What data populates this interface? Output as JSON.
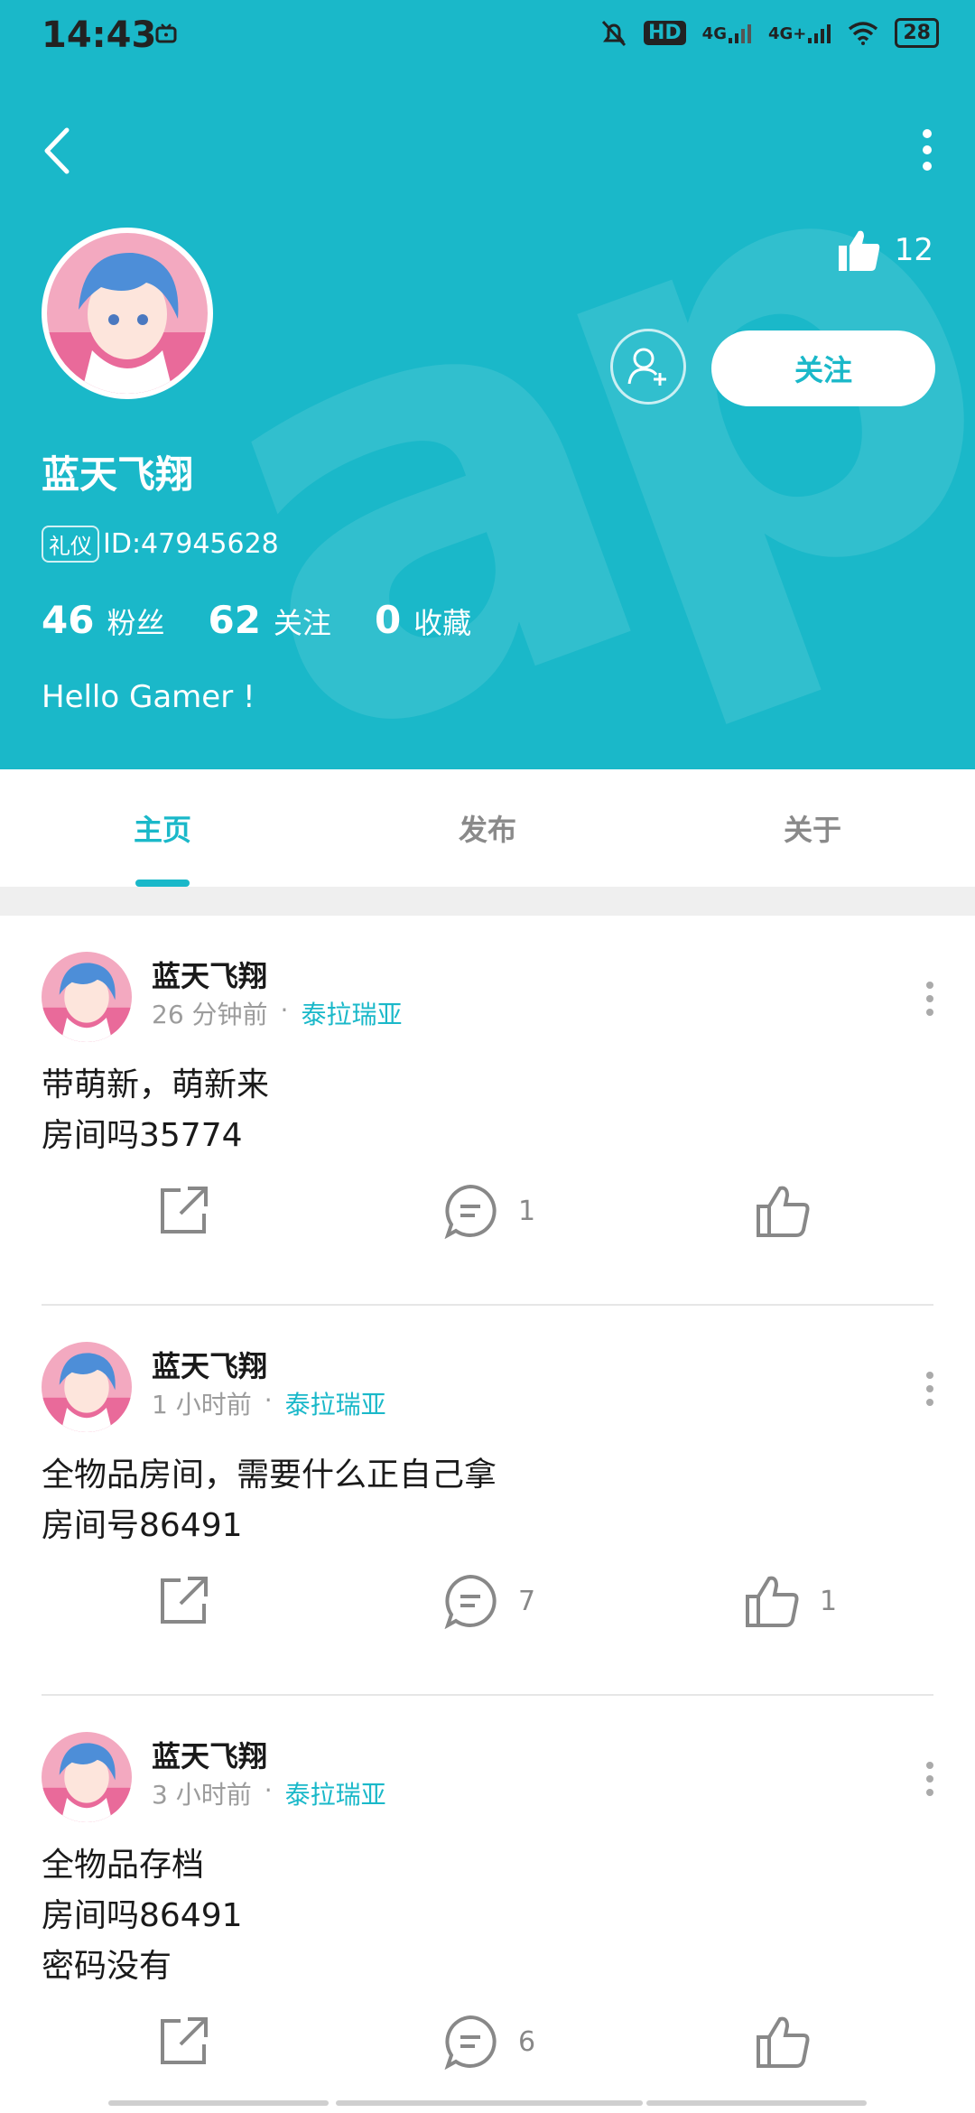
{
  "status_bar": {
    "time": "14:43",
    "battery": "28",
    "hd": "HD",
    "net1": "4G",
    "net2": "4G+"
  },
  "header": {
    "likes_count": "12",
    "follow_label": "关注",
    "username": "蓝天飞翔",
    "badge": "礼仪",
    "id_text": "ID:47945628",
    "stats": [
      {
        "num": "46",
        "label": "粉丝"
      },
      {
        "num": "62",
        "label": "关注"
      },
      {
        "num": "0",
        "label": "收藏"
      }
    ],
    "bio": "Hello Gamer !",
    "accent": "#1ab8c9"
  },
  "tabs": [
    {
      "label": "主页",
      "active": true
    },
    {
      "label": "发布",
      "active": false
    },
    {
      "label": "关于",
      "active": false
    }
  ],
  "posts": [
    {
      "author": "蓝天飞翔",
      "time": "26 分钟前",
      "dot": "·",
      "forum": "泰拉瑞亚",
      "lines": [
        "带萌新，萌新来",
        "房间吗35774"
      ],
      "comments": "1",
      "likes": ""
    },
    {
      "author": "蓝天飞翔",
      "time": "1 小时前",
      "dot": "·",
      "forum": "泰拉瑞亚",
      "lines": [
        "全物品房间，需要什么正自己拿",
        "房间号86491"
      ],
      "comments": "7",
      "likes": "1"
    },
    {
      "author": "蓝天飞翔",
      "time": "3 小时前",
      "dot": "·",
      "forum": "泰拉瑞亚",
      "lines": [
        "全物品存档",
        "房间吗86491",
        "密码没有"
      ],
      "comments": "6",
      "likes": ""
    }
  ]
}
